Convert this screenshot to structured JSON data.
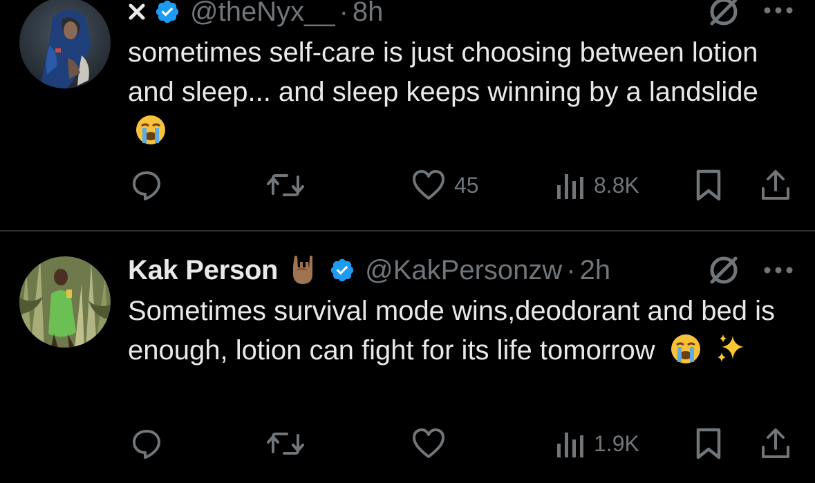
{
  "tweets": [
    {
      "display_name": "",
      "prefix_icon": "x-close-icon",
      "verified": true,
      "handle": "@theNyx__",
      "dot": "·",
      "time": "8h",
      "text": "sometimes self-care is just choosing between lotion and sleep... and sleep keeps winning by a landslide",
      "emoji": [
        "loudly-crying-face"
      ],
      "reply_count": "",
      "retweet_count": "",
      "like_count": "45",
      "view_count": "8.8K"
    },
    {
      "display_name": "Kak Person",
      "name_emoji": "sign-of-horns",
      "verified": true,
      "handle": "@KakPersonzw",
      "dot": "·",
      "time": "2h",
      "text": "Sometimes survival mode wins,deodorant and bed is enough, lotion can fight for its life tomorrow",
      "emoji": [
        "loudly-crying-face",
        "sparkles"
      ],
      "reply_count": "",
      "retweet_count": "",
      "like_count": "",
      "view_count": "1.9K"
    }
  ],
  "colors": {
    "background": "#000000",
    "text": "#e7e9ea",
    "muted": "#71767b",
    "divider": "#2f3336",
    "verified": "#1d9bf0"
  }
}
